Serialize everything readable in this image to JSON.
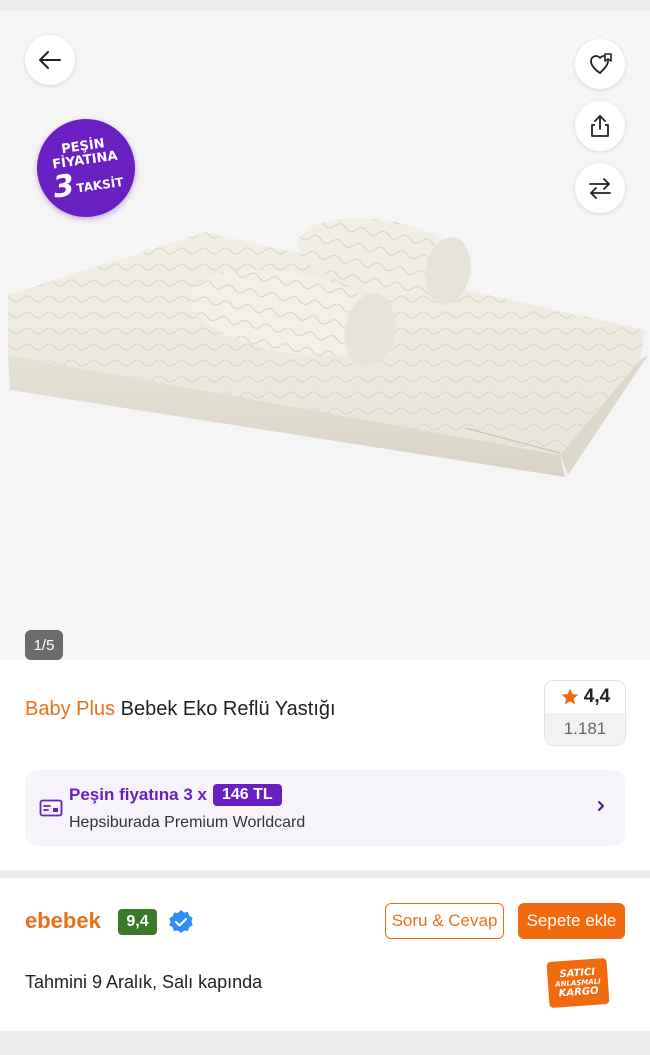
{
  "gallery": {
    "badge": {
      "line1": "PEŞİN",
      "line2": "FİYATINA",
      "number": "3",
      "word": "TAKSİT"
    },
    "counter": "1/5",
    "icons": [
      "back-arrow-icon",
      "heart-bookmark-icon",
      "share-icon",
      "compare-arrows-icon"
    ]
  },
  "product": {
    "brand": "Baby Plus",
    "name": "Bebek Eko Reflü Yastığı",
    "rating": "4,4",
    "review_count": "1.181"
  },
  "installment": {
    "prefix": "Peşin fiyatına 3 x",
    "amount": "146 TL",
    "card_name": "Hepsiburada Premium Worldcard"
  },
  "seller": {
    "name": "ebebek",
    "score": "9,4",
    "qa_button": "Soru & Cevap",
    "cart_button": "Sepete ekle",
    "delivery_text": "Tahmini 9 Aralık, Salı kapında",
    "kargo_badge": {
      "line1": "SATICI",
      "line2": "ANLAŞMALI",
      "line3": "KARGO"
    }
  },
  "colors": {
    "accent_orange": "#f26a10",
    "brand_text": "#e8701a",
    "purple": "#6a1fc2",
    "score_green": "#3b7a2a",
    "verified_blue": "#2f8ef5",
    "star": "#f26a10"
  }
}
